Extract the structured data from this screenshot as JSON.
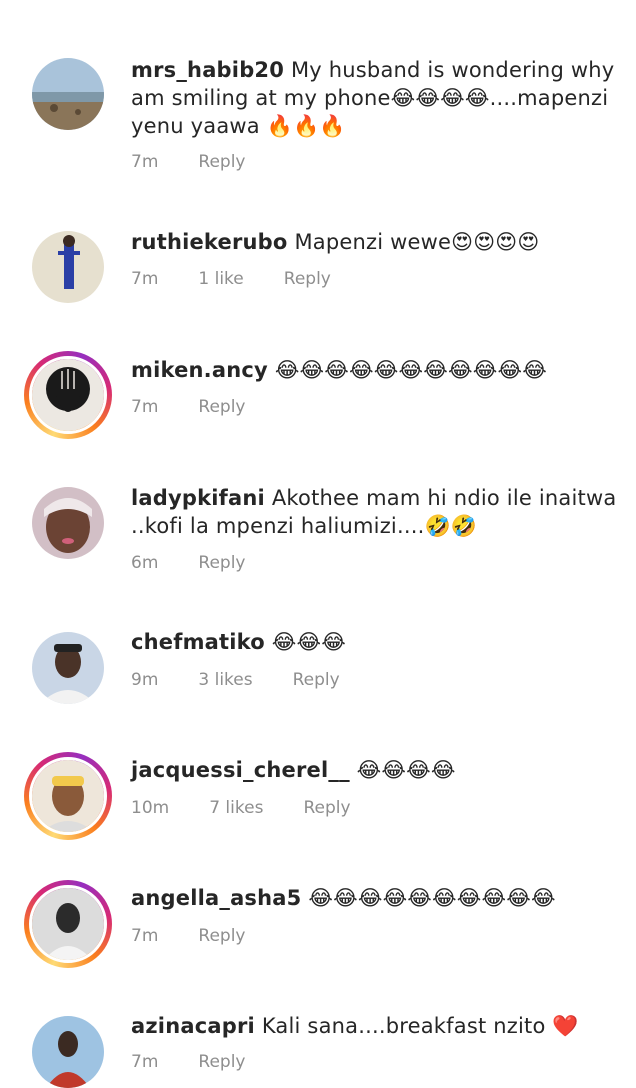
{
  "comments": [
    {
      "username": "mrs_habib20",
      "text": "My husband is wondering why am smiling at my phone😂😂😂😂....mapenzi yenu yaawa 🔥🔥🔥",
      "time": "7m",
      "likes": "",
      "reply": "Reply",
      "story_ring": false,
      "avatar_colors": [
        "#9bb6cf",
        "#6b5b45"
      ]
    },
    {
      "username": "ruthiekerubo",
      "text": "Mapenzi wewe😍😍😍😍",
      "time": "7m",
      "likes": "1 like",
      "reply": "Reply",
      "story_ring": false,
      "avatar_colors": [
        "#d9d3c4",
        "#2a3fa6"
      ]
    },
    {
      "username": "miken.ancy",
      "text": "😂😂😂😂😂😂😂😂😂😂😂",
      "time": "7m",
      "likes": "",
      "reply": "Reply",
      "story_ring": true,
      "avatar_colors": [
        "#e7e2dc",
        "#1a1a1a"
      ]
    },
    {
      "username": "ladypkifani",
      "text": "Akothee mam hi ndio ile inaitwa ..kofi la mpenzi haliumizi....🤣🤣",
      "time": "6m",
      "likes": "",
      "reply": "Reply",
      "story_ring": false,
      "avatar_colors": [
        "#c9b7c0",
        "#5a3a2e"
      ]
    },
    {
      "username": "chefmatiko",
      "text": "😂😂😂",
      "time": "9m",
      "likes": "3 likes",
      "reply": "Reply",
      "story_ring": false,
      "avatar_colors": [
        "#c4d3e6",
        "#3a2b22"
      ]
    },
    {
      "username": "jacquessi_cherel__",
      "text": "😂😂😂😂",
      "time": "10m",
      "likes": "7 likes",
      "reply": "Reply",
      "story_ring": true,
      "avatar_colors": [
        "#e9e1d6",
        "#7a4a2c"
      ]
    },
    {
      "username": "angella_asha5",
      "text": "😂😂😂😂😂😂😂😂😂😂",
      "time": "7m",
      "likes": "",
      "reply": "Reply",
      "story_ring": true,
      "avatar_colors": [
        "#d5d5d5",
        "#2b2b2b"
      ]
    },
    {
      "username": "azinacapri",
      "text": "Kali sana....breakfast nzito ❤️",
      "time": "7m",
      "likes": "",
      "reply": "Reply",
      "story_ring": false,
      "avatar_colors": [
        "#9ec3e2",
        "#c0392b"
      ]
    }
  ]
}
